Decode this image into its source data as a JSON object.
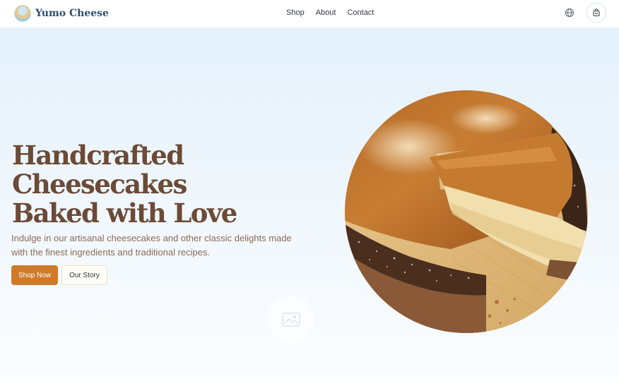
{
  "header": {
    "brand": "Yumo Cheese",
    "logo_icon": "cheese-logo-icon",
    "nav": [
      {
        "label": "Shop"
      },
      {
        "label": "About"
      },
      {
        "label": "Contact"
      }
    ],
    "language_icon": "globe-icon",
    "cart_icon": "shopping-bag-icon"
  },
  "hero": {
    "title_lines": [
      "Handcrafted",
      "Cheesecakes",
      "Baked with Love"
    ],
    "subtitle_lines": [
      "Indulge in our artisanal cheesecakes and other classic delights made",
      "with the finest ingredients and traditional recipes."
    ],
    "primary_cta": "Shop Now",
    "secondary_cta": "Our Story",
    "image_icon": "image-placeholder-icon",
    "hero_image": "caramel-cheesecake-photo"
  },
  "colors": {
    "brand_text": "#2f4f6b",
    "title": "#6b4a36",
    "subtitle": "#8a6a57",
    "primary_button": "#cf7a28",
    "hero_bg": "#e4f1fb"
  }
}
